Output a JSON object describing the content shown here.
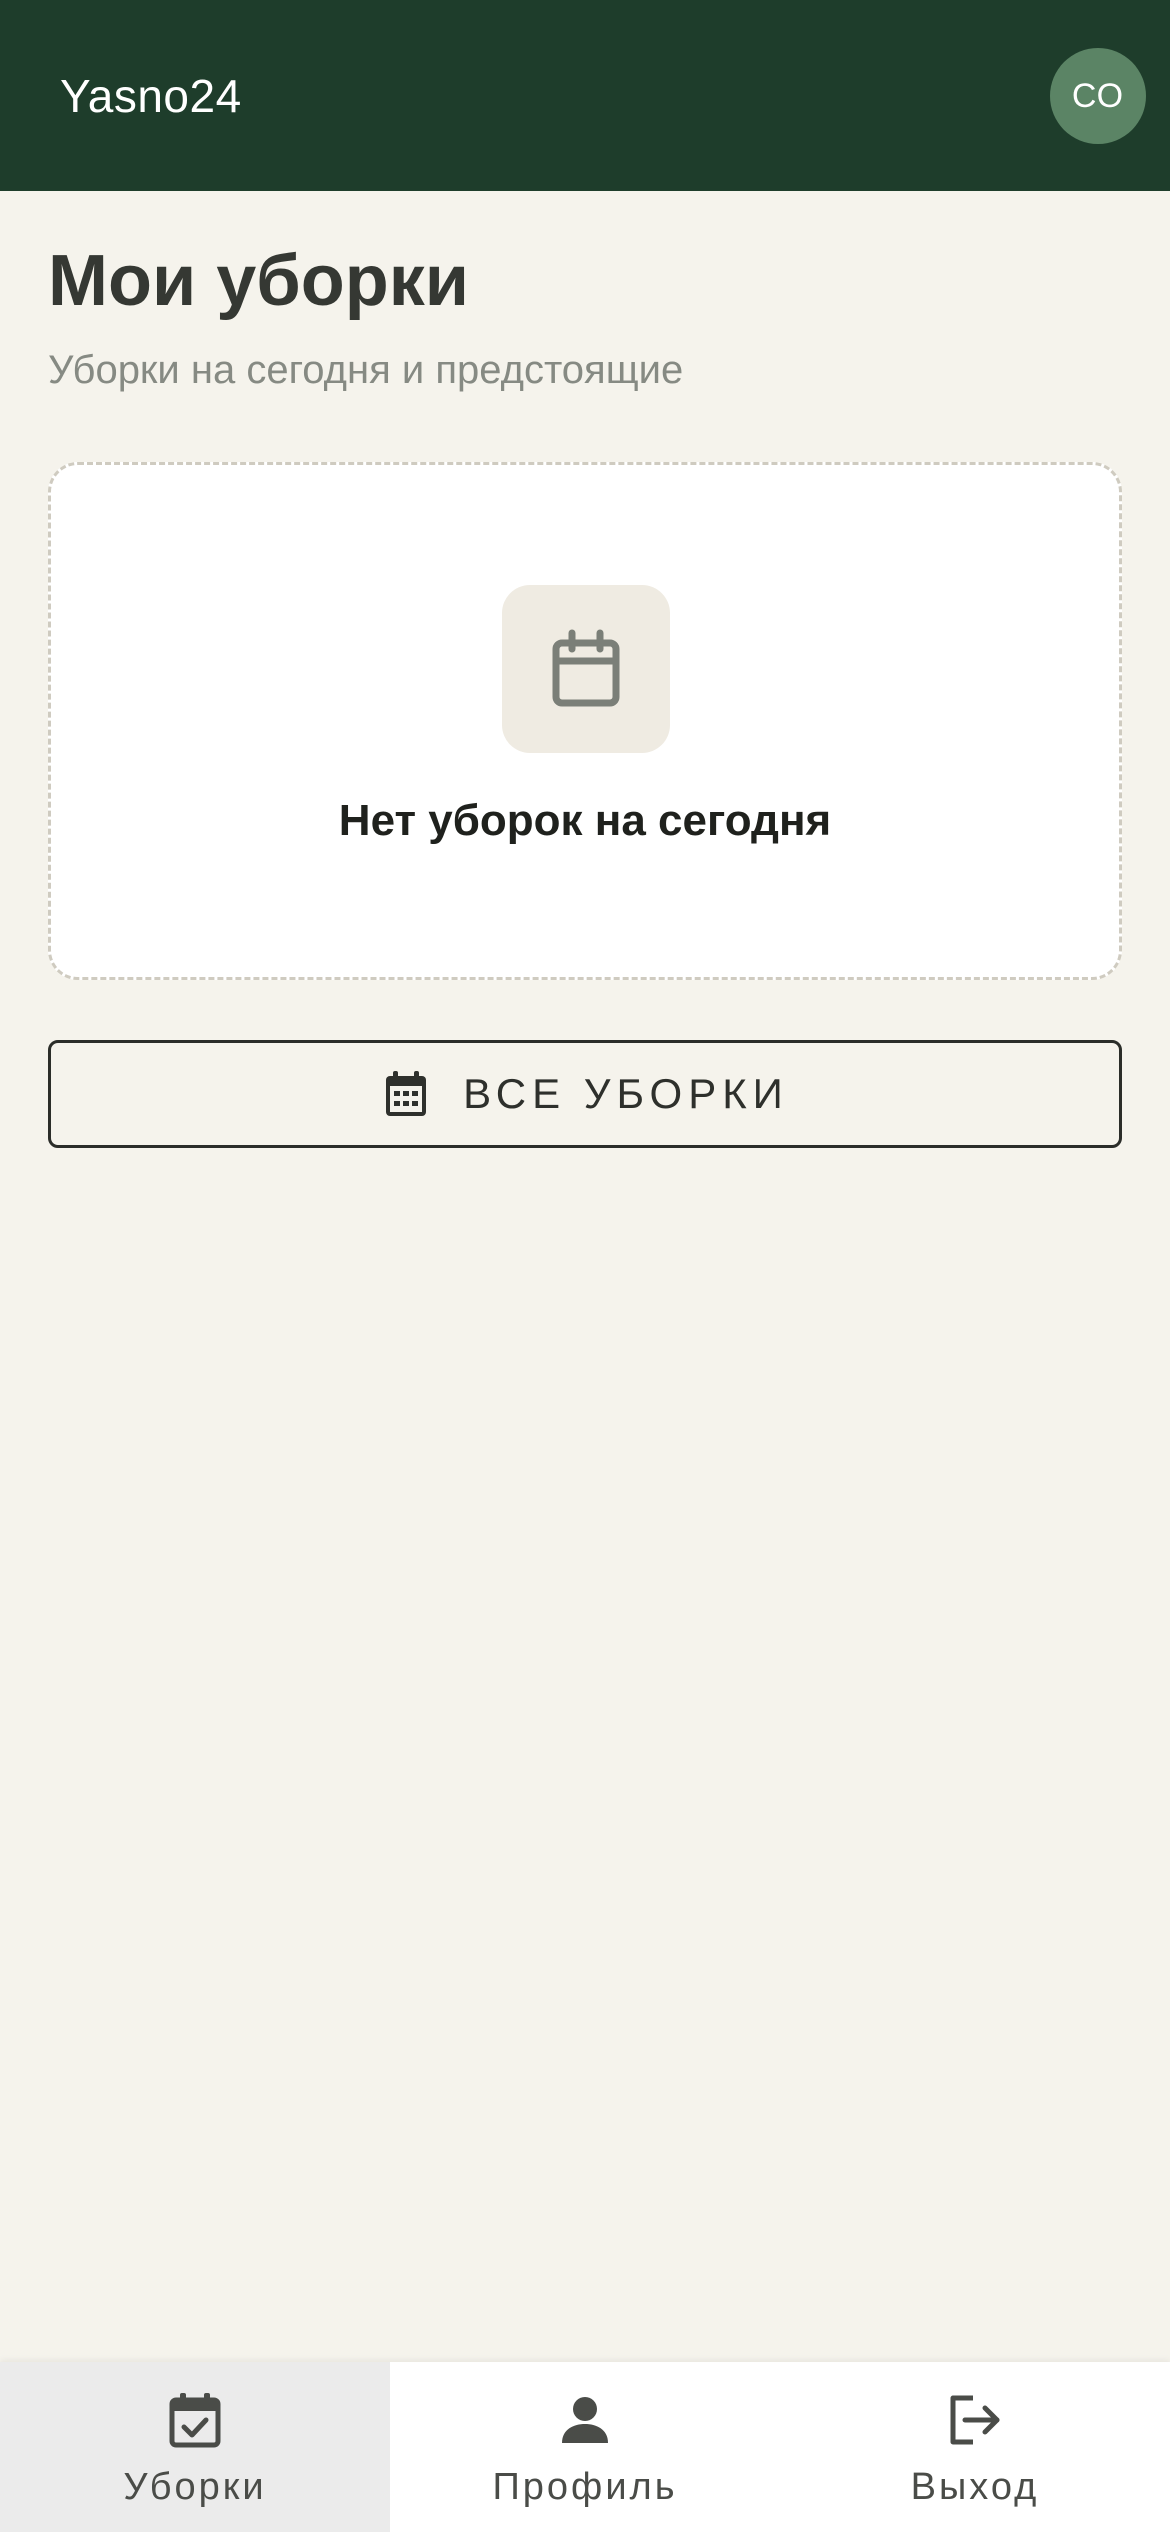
{
  "header": {
    "app_title": "Yasno24",
    "avatar_initials": "СО"
  },
  "main": {
    "title": "Мои уборки",
    "subtitle": "Уборки на сегодня и предстоящие",
    "empty_state": {
      "icon": "calendar-icon",
      "message": "Нет уборок на сегодня"
    },
    "all_button": {
      "icon": "calendar-month-icon",
      "label": "ВСЕ УБОРКИ"
    }
  },
  "bottom_nav": {
    "items": [
      {
        "label": "Уборки",
        "icon": "calendar-check-icon",
        "active": true
      },
      {
        "label": "Профиль",
        "icon": "person-icon",
        "active": false
      },
      {
        "label": "Выход",
        "icon": "logout-icon",
        "active": false
      }
    ]
  },
  "colors": {
    "header_bg": "#1e3d2b",
    "avatar_bg": "#5b8465",
    "page_bg": "#f5f3ec",
    "card_bg": "#ffffff",
    "active_nav_bg": "#ebebeb"
  }
}
